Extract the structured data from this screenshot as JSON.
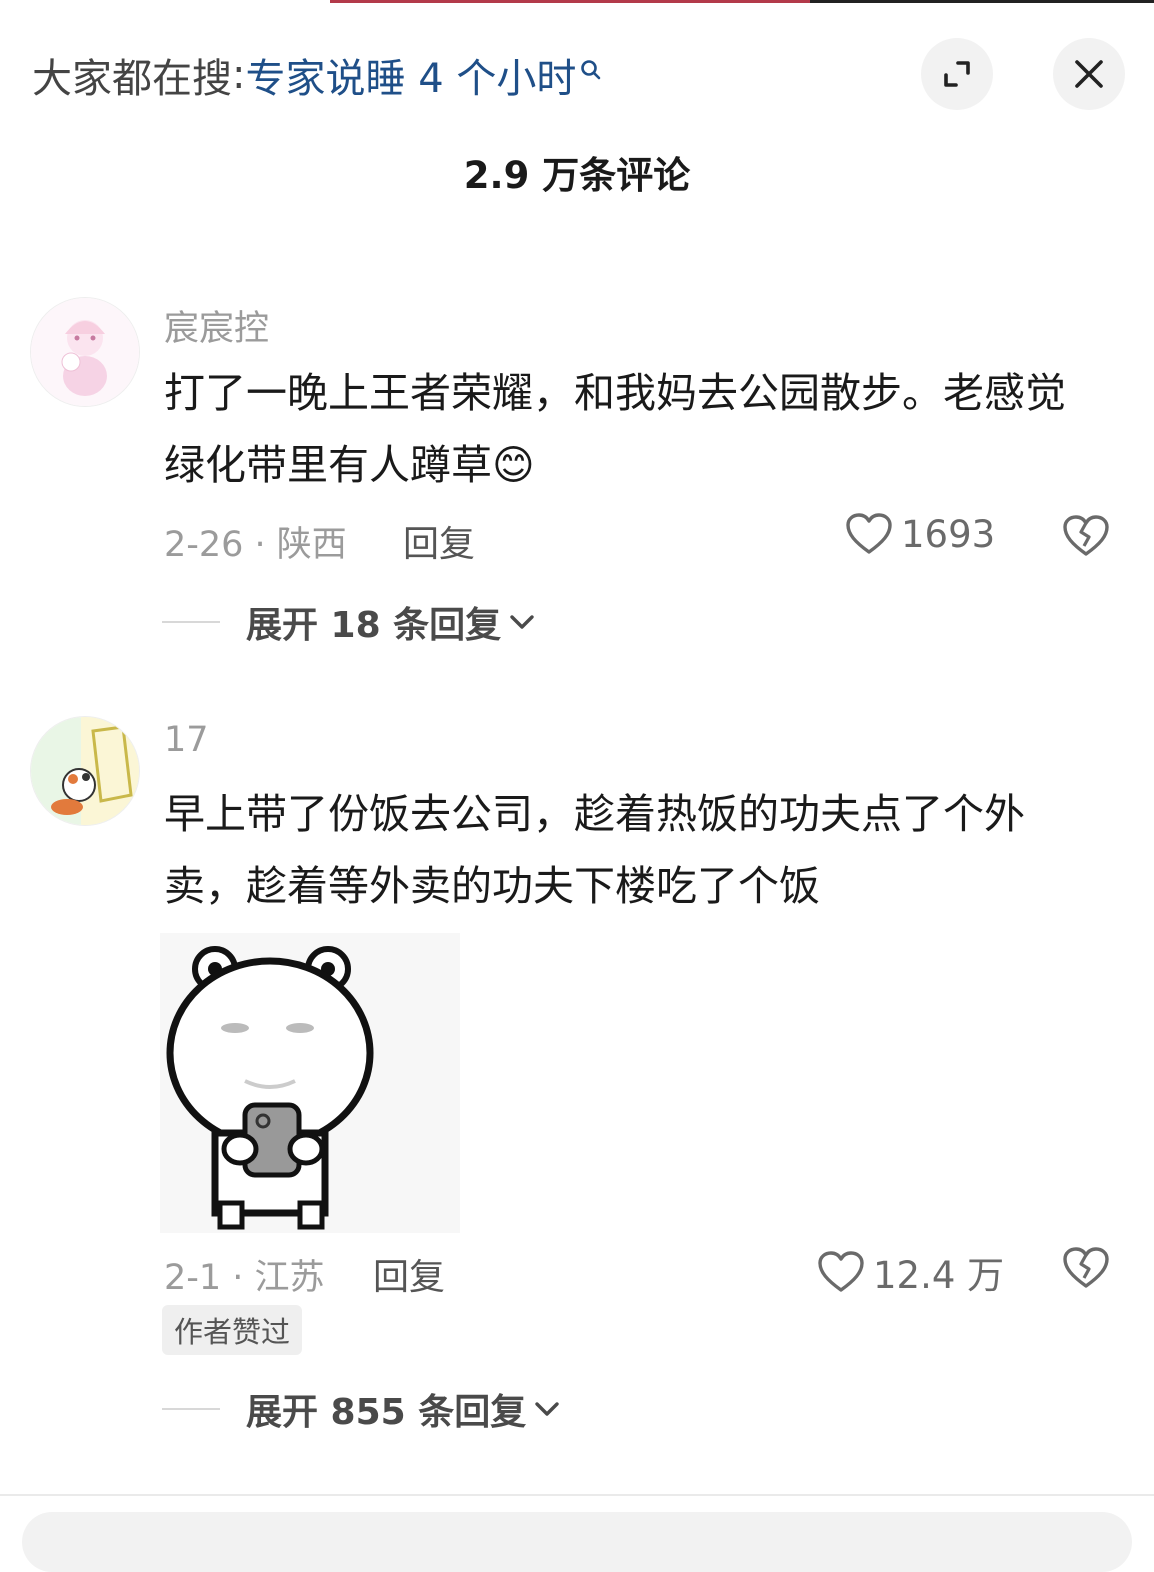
{
  "header": {
    "search_prefix": "大家都在搜",
    "search_separator": ":",
    "search_term": "专家说睡 4 个小时",
    "expand_icon": "expand-icon",
    "close_icon": "close-icon"
  },
  "comments_count_title": "2.9 万条评论",
  "comments": [
    {
      "username": "宸宸控",
      "text": "打了一晚上王者荣耀，和我妈去公园散步。老感觉绿化带里有人蹲草😊",
      "date_location": "2-26 · 陕西",
      "reply_label": "回复",
      "like_count": "1693",
      "expand_replies": "展开 18 条回复"
    },
    {
      "username": "17",
      "text": "早上带了份饭去公司，趁着热饭的功夫点了个外卖，趁着等外卖的功夫下楼吃了个饭",
      "date_location": "2-1 · 江苏",
      "reply_label": "回复",
      "like_count": "12.4 万",
      "author_badge": "作者赞过",
      "expand_replies": "展开 855 条回复"
    }
  ],
  "colors": {
    "search_term": "#1f4f88",
    "muted": "#9b9b9b",
    "text": "#1a1a1a"
  }
}
